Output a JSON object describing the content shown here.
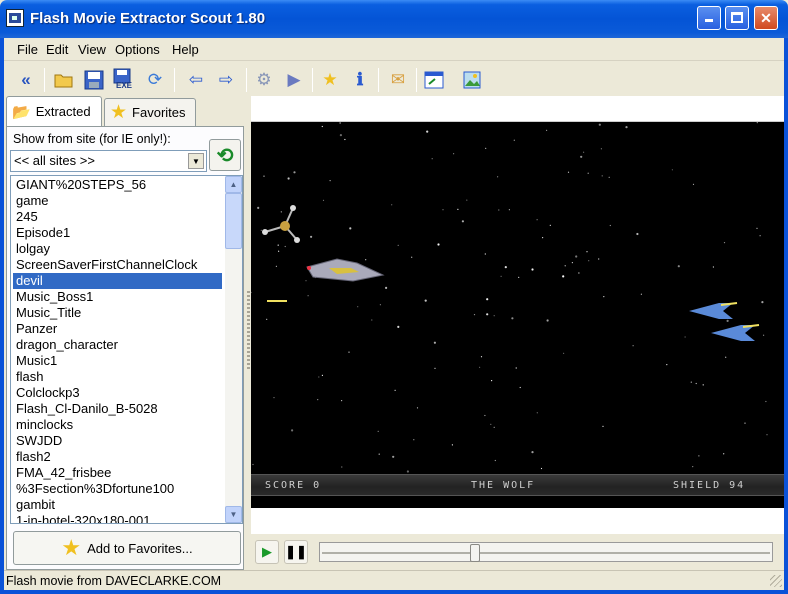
{
  "window": {
    "title": "Flash Movie Extractor Scout 1.80"
  },
  "menu": [
    "File",
    "Edit",
    "View",
    "Options",
    "Help"
  ],
  "toolbar_icons": [
    "rewind-icon",
    "open-folder-icon",
    "save-icon",
    "save-exe-icon",
    "convert-icon",
    "back-arrow-icon",
    "forward-arrow-icon",
    "refresh-gear-icon",
    "export-icon",
    "favorite-star-icon",
    "info-icon",
    "email-icon",
    "window-icon",
    "image-icon"
  ],
  "toolbar_exe_label": "EXE",
  "tabs": {
    "extracted": "Extracted",
    "favorites": "Favorites"
  },
  "filter": {
    "label": "Show from site (for IE only!):",
    "selected": "<< all sites >>"
  },
  "movies": [
    "GIANT%20STEPS_56",
    "game",
    "245",
    "Episode1",
    "lolgay",
    "ScreenSaverFirstChannelClock",
    "devil",
    "Music_Boss1",
    "Music_Title",
    "Panzer",
    "dragon_character",
    "Music1",
    "flash",
    "Colclockp3",
    "Flash_Cl-Danilo_B-5028",
    "minclocks",
    "SWJDD",
    "flash2",
    "FMA_42_frisbee",
    "%3Fsection%3Dfortune100",
    "gambit",
    "1-in-hotel-320x180-001"
  ],
  "selected_index": 6,
  "add_favorites_label": "Add to Favorites...",
  "game_hud": {
    "score": "SCORE  0",
    "title": "THE WOLF",
    "shield": "SHIELD 94"
  },
  "playback": {
    "position_fraction": 0.34
  },
  "status": "Flash movie from DAVECLARKE.COM"
}
